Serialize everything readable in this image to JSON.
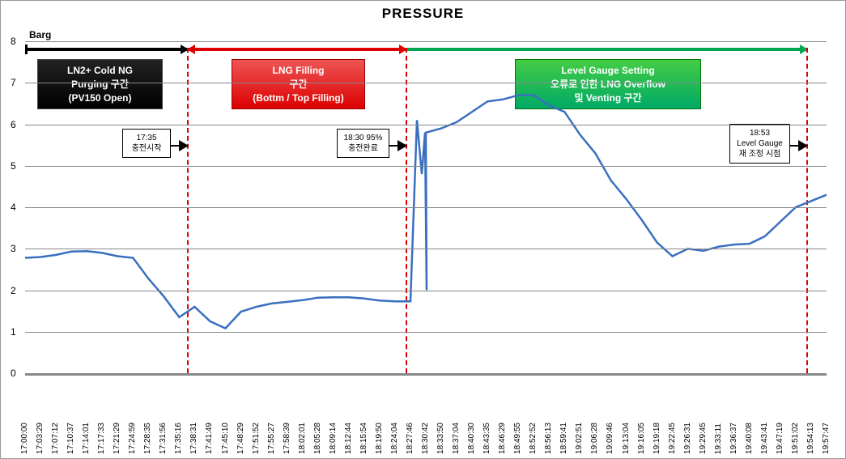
{
  "chart_data": {
    "type": "line",
    "title": "PRESSURE",
    "ylabel": "Barg",
    "ylim": [
      0,
      8
    ],
    "x_ticks": [
      "17:00:00",
      "17:03:29",
      "17:07:12",
      "17:10:37",
      "17:14:01",
      "17:17:33",
      "17:21:29",
      "17:24:59",
      "17:28:35",
      "17:31:56",
      "17:35:16",
      "17:38:31",
      "17:41:49",
      "17:45:10",
      "17:48:29",
      "17:51:52",
      "17:55:27",
      "17:58:39",
      "18:02:01",
      "18:05:28",
      "18:09:14",
      "18:12:44",
      "18:15:54",
      "18:19:50",
      "18:24:04",
      "18:27:46",
      "18:30:42",
      "18:33:50",
      "18:37:04",
      "18:40:30",
      "18:43:35",
      "18:46:29",
      "18:49:55",
      "18:52:52",
      "18:56:13",
      "18:59:41",
      "19:02:51",
      "19:06:28",
      "19:09:46",
      "19:13:04",
      "19:16:05",
      "19:19:18",
      "19:22:45",
      "19:26:31",
      "19:29:45",
      "19:33:11",
      "19:36:37",
      "19:40:08",
      "19:43:41",
      "19:47:19",
      "19:51:02",
      "19:54:13",
      "19:57:47"
    ],
    "values": [
      2.78,
      2.8,
      2.85,
      2.93,
      2.94,
      2.9,
      2.82,
      2.78,
      2.28,
      1.85,
      1.35,
      1.6,
      1.25,
      1.08,
      1.48,
      1.6,
      1.68,
      1.72,
      1.76,
      1.82,
      1.83,
      1.83,
      1.8,
      1.75,
      1.73,
      1.73,
      5.8,
      5.9,
      6.05,
      6.3,
      6.55,
      6.6,
      6.7,
      6.7,
      6.45,
      6.3,
      5.75,
      5.3,
      4.65,
      4.2,
      3.7,
      3.15,
      2.82,
      3.0,
      2.95,
      3.05,
      3.1,
      3.12,
      3.3,
      3.65,
      4.0,
      4.15,
      4.3
    ],
    "zones": [
      {
        "label_lines": [
          "LN2+ Cold NG",
          "Purging 구간",
          "(PV150 Open)"
        ],
        "x_start": "17:00:00",
        "x_end": "17:35:00",
        "color": "black"
      },
      {
        "label_lines": [
          "LNG Filling",
          "구간",
          "(Bottm / Top Filling)"
        ],
        "x_start": "17:35:00",
        "x_end": "18:30:00",
        "color": "red"
      },
      {
        "label_lines": [
          "Level Gauge Setting",
          "오류로 인한 LNG Overflow",
          "및 Venting 구간"
        ],
        "x_start": "18:30:00",
        "x_end": "19:53:00",
        "color": "green"
      }
    ],
    "annotations": [
      {
        "lines": [
          "17:35",
          "충전시작"
        ],
        "x": "17:35"
      },
      {
        "lines": [
          "18:30 95%",
          "충전완료"
        ],
        "x": "18:30"
      },
      {
        "lines": [
          "18:53",
          "Level Gauge",
          "재 조정 시점"
        ],
        "x": "19:53"
      }
    ]
  },
  "ui": {
    "title": "PRESSURE",
    "ylabel": "Barg"
  },
  "zonebox": {
    "black_l1": "LN2+ Cold NG",
    "black_l2": "Purging 구간",
    "black_l3": "(PV150 Open)",
    "red_l1": "LNG Filling",
    "red_l2": "구간",
    "red_l3": "(Bottm / Top Filling)",
    "green_l1": "Level Gauge Setting",
    "green_l2": "오류로 인한 LNG Overflow",
    "green_l3": "및 Venting 구간"
  },
  "anno": {
    "a1_l1": "17:35",
    "a1_l2": "충전시작",
    "a2_l1": "18:30 95%",
    "a2_l2": "충전완료",
    "a3_l1": "18:53",
    "a3_l2": "Level Gauge",
    "a3_l3": "재 조정 시점"
  }
}
